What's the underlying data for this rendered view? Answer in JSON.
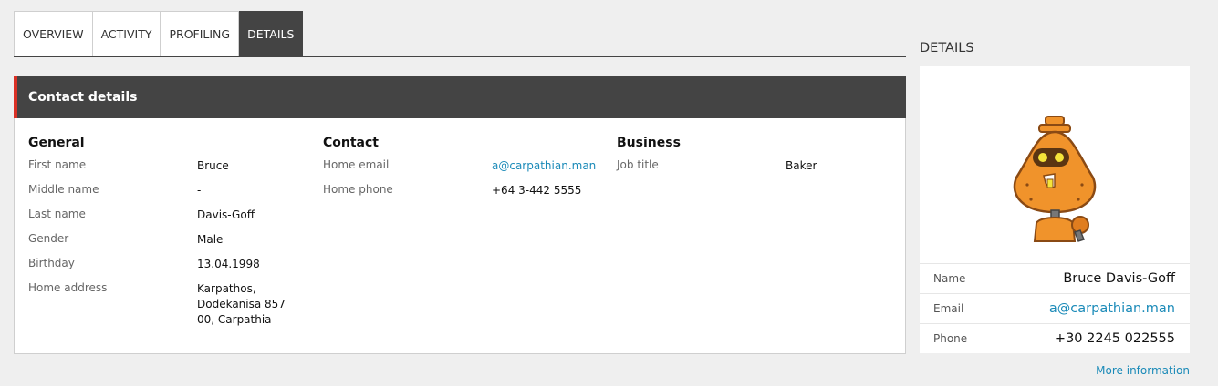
{
  "tabs": [
    "OVERVIEW",
    "ACTIVITY",
    "PROFILING",
    "DETAILS"
  ],
  "active_tab": "DETAILS",
  "panel": {
    "title": "Contact details",
    "general": {
      "heading": "General",
      "fields": [
        {
          "label": "First name",
          "value": "Bruce"
        },
        {
          "label": "Middle name",
          "value": "-"
        },
        {
          "label": "Last name",
          "value": "Davis-Goff"
        },
        {
          "label": "Gender",
          "value": "Male"
        },
        {
          "label": "Birthday",
          "value": "13.04.1998"
        },
        {
          "label": "Home address",
          "value": "Karpathos,\nDodekanisa 857\n00, Carpathia"
        }
      ]
    },
    "contact": {
      "heading": "Contact",
      "fields": [
        {
          "label": "Home email",
          "value": "a@carpathian.man"
        },
        {
          "label": "Home phone",
          "value": "+64 3-442 5555"
        }
      ]
    },
    "business": {
      "heading": "Business",
      "fields": [
        {
          "label": "Job title",
          "value": "Baker"
        }
      ]
    }
  },
  "side": {
    "title": "DETAILS",
    "name_label": "Name",
    "name_value": "Bruce Davis-Goff",
    "email_label": "Email",
    "email_value": "a@carpathian.man",
    "phone_label": "Phone",
    "phone_value": "+30 2245 022555",
    "more_link": "More information"
  },
  "colors": {
    "accent": "#d93025",
    "header_bg": "#444444",
    "link": "#1a8ab8",
    "avatar_orange": "#f0932b"
  }
}
